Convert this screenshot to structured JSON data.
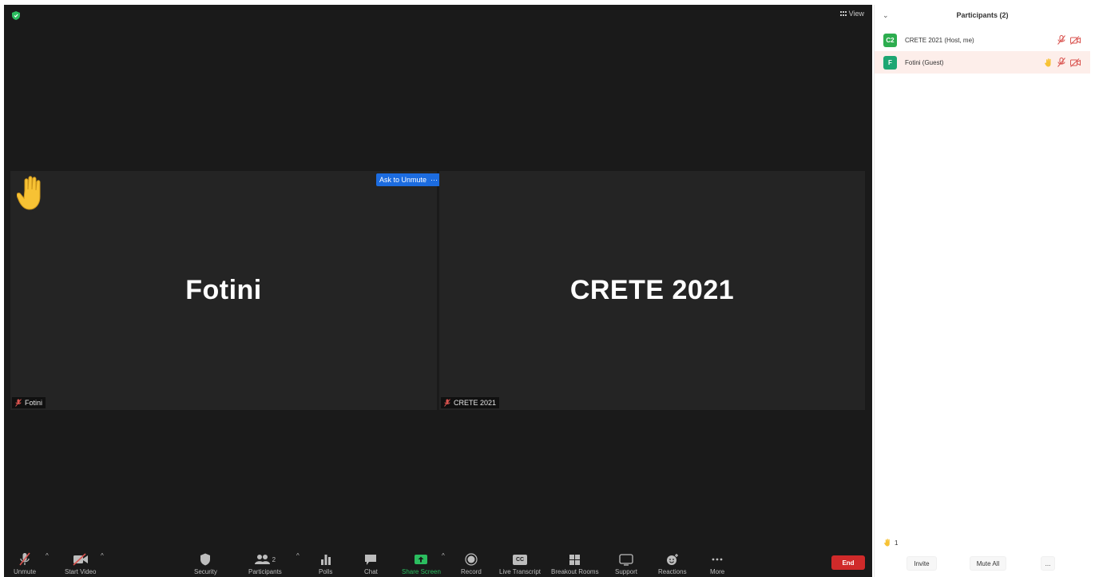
{
  "meeting": {
    "view_label": "View",
    "tiles": [
      {
        "name": "Fotini",
        "tag": "Fotini"
      },
      {
        "name": "CRETE 2021",
        "tag": "CRETE 2021"
      }
    ],
    "ask_to_unmute_label": "Ask to Unmute",
    "ask_more_label": "···"
  },
  "toolbar": {
    "unmute": "Unmute",
    "start_video": "Start Video",
    "security": "Security",
    "participants": "Participants",
    "participants_count": "2",
    "polls": "Polls",
    "chat": "Chat",
    "share_screen": "Share Screen",
    "record": "Record",
    "live_transcript": "Live Transcript",
    "breakout_rooms": "Breakout Rooms",
    "support": "Support",
    "reactions": "Reactions",
    "more": "More",
    "end": "End",
    "caret": "^",
    "cc": "CC"
  },
  "panel": {
    "title": "Participants (2)",
    "collapse": "⌄",
    "participants": [
      {
        "initials": "C2",
        "name": "CRETE 2021 (Host, me)",
        "color": "#2dad4f"
      },
      {
        "initials": "F",
        "name": "Fotini (Guest)",
        "color": "#1ea672"
      }
    ],
    "raised_hands_count": "1",
    "invite": "Invite",
    "mute_all": "Mute All",
    "more": "..."
  },
  "colors": {
    "accent_blue": "#1c6ce0",
    "end_red": "#d02a2a",
    "share_green": "#2bbd5f",
    "mute_red": "#d9534f"
  }
}
